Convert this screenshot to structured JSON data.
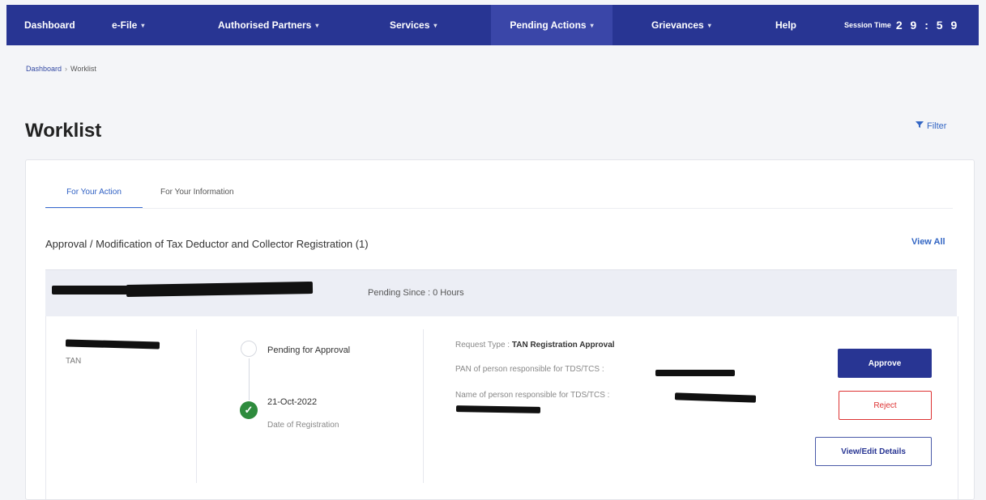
{
  "nav": {
    "items": [
      {
        "label": "Dashboard",
        "caret": ""
      },
      {
        "label": "e-File",
        "caret": "▾"
      },
      {
        "label": "Authorised Partners",
        "caret": "▾"
      },
      {
        "label": "Services",
        "caret": "▾"
      },
      {
        "label": "Pending Actions",
        "caret": "▾"
      },
      {
        "label": "Grievances",
        "caret": "▾"
      },
      {
        "label": "Help",
        "caret": ""
      }
    ],
    "active_item": "Pending Actions",
    "session_label": "Session Time",
    "session_value": "2 9 : 5 9",
    "bar_color": "#283593"
  },
  "breadcrumb": {
    "root": "Dashboard",
    "separator": "›",
    "current": "Worklist"
  },
  "page": {
    "title": "Worklist",
    "filter_label": "Filter",
    "filter_icon": "filter-icon"
  },
  "tabs": [
    {
      "label": "For Your Action",
      "active": true
    },
    {
      "label": "For Your Information",
      "active": false
    }
  ],
  "section": {
    "title": "Approval / Modification of Tax Deductor and Collector Registration (1)",
    "view_all": "View All"
  },
  "item": {
    "pending_since": "Pending Since : 0 Hours",
    "id_label": "TAN",
    "status": "Pending for Approval",
    "date": "21-Oct-2022",
    "date_label": "Date of Registration",
    "request_type_label": "Request Type : ",
    "request_type_value": "TAN Registration Approval",
    "pan_label": "PAN of person responsible for TDS/TCS : ",
    "name_label": "Name of person responsible for TDS/TCS : ",
    "status_icon": "check-circle-icon"
  },
  "actions": {
    "approve": "Approve",
    "reject": "Reject",
    "view_edit": "View/Edit Details"
  },
  "colors": {
    "primary": "#283593",
    "reject": "#d33333",
    "link": "#3366c4",
    "success": "#2e8b3d"
  }
}
